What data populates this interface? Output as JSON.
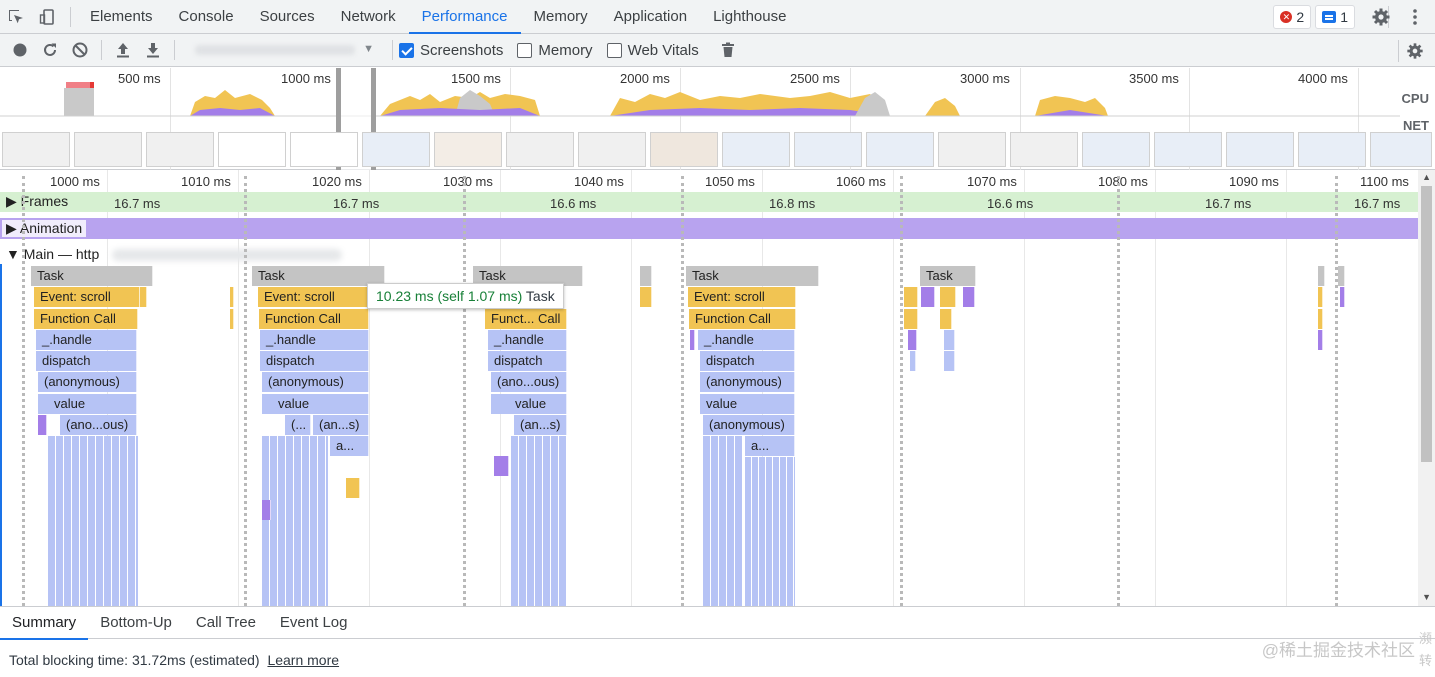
{
  "tabs": [
    "Elements",
    "Console",
    "Sources",
    "Network",
    "Performance",
    "Memory",
    "Application",
    "Lighthouse"
  ],
  "active_tab": "Performance",
  "badges": {
    "errors": "2",
    "messages": "1"
  },
  "toolbar": {
    "screenshots_label": "Screenshots",
    "memory_label": "Memory",
    "web_vitals_label": "Web Vitals",
    "profile_arrow": "▼"
  },
  "overview": {
    "ticks": [
      "500 ms",
      "1000 ms",
      "1500 ms",
      "2000 ms",
      "2500 ms",
      "3000 ms",
      "3500 ms",
      "4000 ms"
    ],
    "cpu_label": "CPU",
    "net_label": "NET"
  },
  "ruler": [
    "1000 ms",
    "1010 ms",
    "1020 ms",
    "1030 ms",
    "1040 ms",
    "1050 ms",
    "1060 ms",
    "1070 ms",
    "1080 ms",
    "1090 ms",
    "1100 ms"
  ],
  "tracks": {
    "frames_label": "Frames",
    "frame_durations": [
      "16.7 ms",
      "16.7 ms",
      "16.6 ms",
      "16.8 ms",
      "16.6 ms",
      "16.7 ms",
      "16.7 ms"
    ],
    "animation_label": "Animation",
    "main_label": "Main — http"
  },
  "flame": {
    "task": "Task",
    "event_scroll": "Event: scroll",
    "function_call": "Function Call",
    "function_call_short": "Funct... Call",
    "handle": "_.handle",
    "dispatch": "dispatch",
    "anonymous": "(anonymous)",
    "anonymous_short": "(ano...ous)",
    "value": "value",
    "ano_ous": "(ano...ous)",
    "an_s": "(an...s)",
    "ellipsis": "(...",
    "a_dots": "a..."
  },
  "tooltip": {
    "duration": "10.23 ms (self 1.07 ms)",
    "name": "Task"
  },
  "bottom_tabs": [
    "Summary",
    "Bottom-Up",
    "Call Tree",
    "Event Log"
  ],
  "summary": {
    "text": "Total blocking time: 31.72ms (estimated)",
    "link": "Learn more"
  },
  "watermark": "@稀土掘金技术社区",
  "watermark_side": "濒转"
}
